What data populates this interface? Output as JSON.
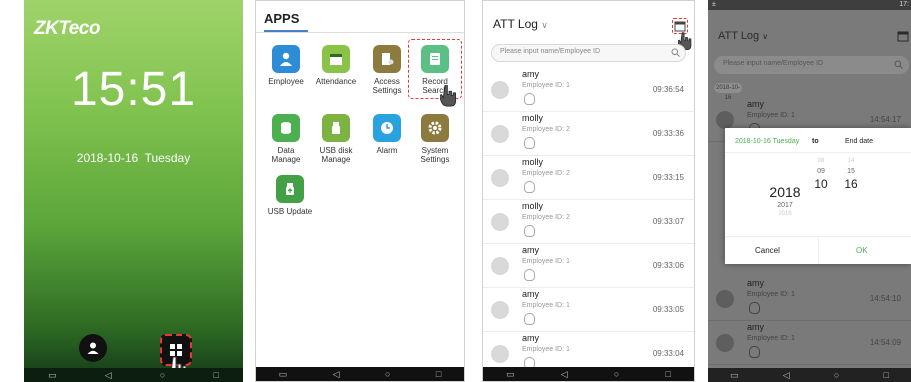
{
  "lock": {
    "brand": "ZKTeco",
    "time": "15:51",
    "date": "2018-10-16",
    "weekday": "Tuesday"
  },
  "apps": {
    "title": "APPS",
    "items": [
      {
        "l1": "Employee",
        "l2": "",
        "color": "#2e8bd6",
        "icon": "person-icon"
      },
      {
        "l1": "Attendance",
        "l2": "",
        "color": "#8bc34a",
        "icon": "calendar-icon"
      },
      {
        "l1": "Access",
        "l2": "Settings",
        "color": "#8d7a3e",
        "icon": "door-icon"
      },
      {
        "l1": "Record",
        "l2": "Search",
        "color": "#5bbf86",
        "icon": "document-icon"
      },
      {
        "l1": "Data",
        "l2": "Manage",
        "color": "#4caf50",
        "icon": "database-icon"
      },
      {
        "l1": "USB disk",
        "l2": "Manage",
        "color": "#7cb342",
        "icon": "usb-icon"
      },
      {
        "l1": "Alarm",
        "l2": "",
        "color": "#29a3e0",
        "icon": "clock-icon"
      },
      {
        "l1": "System",
        "l2": "Settings",
        "color": "#8d7a3e",
        "icon": "gear-icon"
      },
      {
        "l1": "USB Update",
        "l2": "",
        "color": "#43a047",
        "icon": "usb-update-icon"
      }
    ]
  },
  "log": {
    "title": "ATT Log",
    "search_placeholder": "Please input name/Employee ID",
    "rows": [
      {
        "name": "amy",
        "eid": "Employee ID: 1",
        "time": "09:36:54"
      },
      {
        "name": "molly",
        "eid": "Employee ID: 2",
        "time": "09:33:36"
      },
      {
        "name": "molly",
        "eid": "Employee ID: 2",
        "time": "09:33:15"
      },
      {
        "name": "molly",
        "eid": "Employee ID: 2",
        "time": "09:33:07"
      },
      {
        "name": "amy",
        "eid": "Employee ID: 1",
        "time": "09:33:06"
      },
      {
        "name": "amy",
        "eid": "Employee ID: 1",
        "time": "09:33:05"
      },
      {
        "name": "amy",
        "eid": "Employee ID: 1",
        "time": "09:33:04"
      }
    ]
  },
  "log2": {
    "status_left": "±",
    "status_right": "17:",
    "title": "ATT Log",
    "search_placeholder": "Please input name/Employee ID",
    "day": "2018-10-16",
    "rows_top": [
      {
        "name": "amy",
        "eid": "Employee ID: 1",
        "time": "14:54:17"
      }
    ],
    "side_times": [
      "15",
      "14",
      "13"
    ],
    "rows_bottom": [
      {
        "name": "amy",
        "eid": "Employee ID: 1",
        "time": "14:54:10"
      },
      {
        "name": "amy",
        "eid": "Employee ID: 1",
        "time": "14:54:09"
      }
    ]
  },
  "picker": {
    "start": "2018-10-16 Tuesday",
    "to": "to",
    "end": "End date",
    "year_sel": "2018",
    "year_next": "2017",
    "year_far": "2016",
    "month_prev": "09",
    "month_far": "08",
    "month_sel": "10",
    "day_prev": "15",
    "day_far": "14",
    "day_sel": "16",
    "cancel": "Cancel",
    "ok": "OK"
  },
  "colors": {
    "accent": "#4a7fc4",
    "highlight": "#e53935",
    "ok": "#4caf50"
  }
}
